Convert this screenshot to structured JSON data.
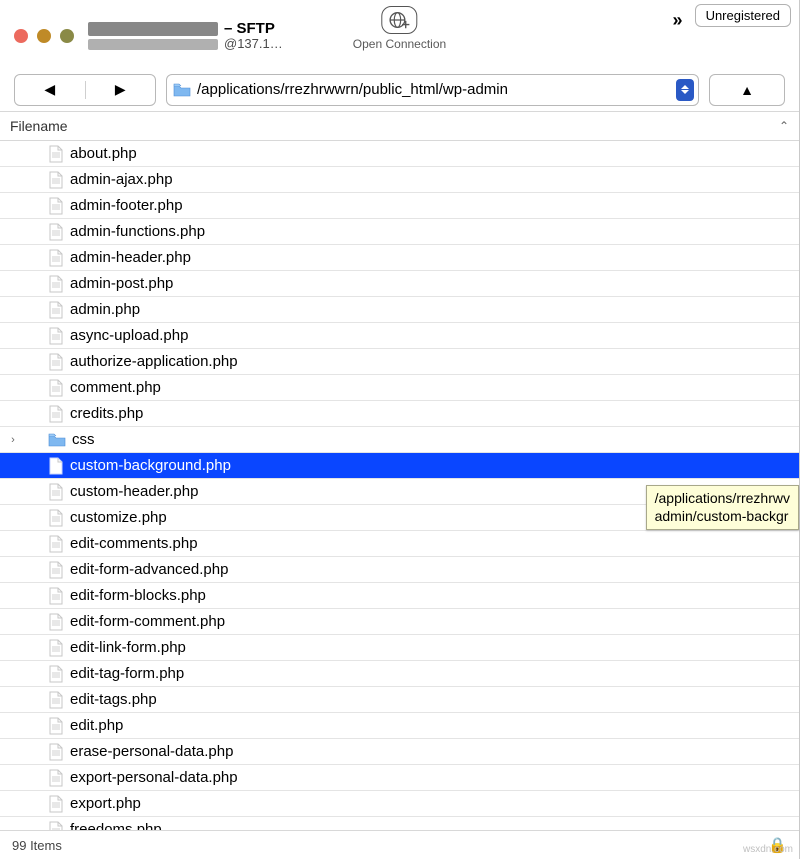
{
  "window": {
    "unregistered_label": "Unregistered",
    "title_suffix": "– SFTP",
    "subtitle_suffix": "@137.1…",
    "toolbar": {
      "open_connection_label": "Open Connection",
      "overflow_glyph": "»"
    }
  },
  "nav": {
    "back_glyph": "◀",
    "forward_glyph": "▶",
    "path": "/applications/rrezhrwwrn/public_html/wp-admin",
    "up_glyph": "▲"
  },
  "columns": {
    "filename_label": "Filename",
    "sort_glyph": "⌃"
  },
  "files": [
    {
      "name": "about.php",
      "type": "file",
      "selected": false
    },
    {
      "name": "admin-ajax.php",
      "type": "file",
      "selected": false
    },
    {
      "name": "admin-footer.php",
      "type": "file",
      "selected": false
    },
    {
      "name": "admin-functions.php",
      "type": "file",
      "selected": false
    },
    {
      "name": "admin-header.php",
      "type": "file",
      "selected": false
    },
    {
      "name": "admin-post.php",
      "type": "file",
      "selected": false
    },
    {
      "name": "admin.php",
      "type": "file",
      "selected": false
    },
    {
      "name": "async-upload.php",
      "type": "file",
      "selected": false
    },
    {
      "name": "authorize-application.php",
      "type": "file",
      "selected": false
    },
    {
      "name": "comment.php",
      "type": "file",
      "selected": false
    },
    {
      "name": "credits.php",
      "type": "file",
      "selected": false
    },
    {
      "name": "css",
      "type": "folder",
      "selected": false,
      "expandable": true
    },
    {
      "name": "custom-background.php",
      "type": "file",
      "selected": true
    },
    {
      "name": "custom-header.php",
      "type": "file",
      "selected": false
    },
    {
      "name": "customize.php",
      "type": "file",
      "selected": false
    },
    {
      "name": "edit-comments.php",
      "type": "file",
      "selected": false
    },
    {
      "name": "edit-form-advanced.php",
      "type": "file",
      "selected": false
    },
    {
      "name": "edit-form-blocks.php",
      "type": "file",
      "selected": false
    },
    {
      "name": "edit-form-comment.php",
      "type": "file",
      "selected": false
    },
    {
      "name": "edit-link-form.php",
      "type": "file",
      "selected": false
    },
    {
      "name": "edit-tag-form.php",
      "type": "file",
      "selected": false
    },
    {
      "name": "edit-tags.php",
      "type": "file",
      "selected": false
    },
    {
      "name": "edit.php",
      "type": "file",
      "selected": false
    },
    {
      "name": "erase-personal-data.php",
      "type": "file",
      "selected": false
    },
    {
      "name": "export-personal-data.php",
      "type": "file",
      "selected": false
    },
    {
      "name": "export.php",
      "type": "file",
      "selected": false
    },
    {
      "name": "freedoms.php",
      "type": "file",
      "selected": false
    }
  ],
  "tooltip": {
    "line1": "/applications/rrezhrwv",
    "line2": "admin/custom-backgr"
  },
  "status": {
    "item_count_label": "99 Items"
  },
  "watermark": "wsxdn.com"
}
